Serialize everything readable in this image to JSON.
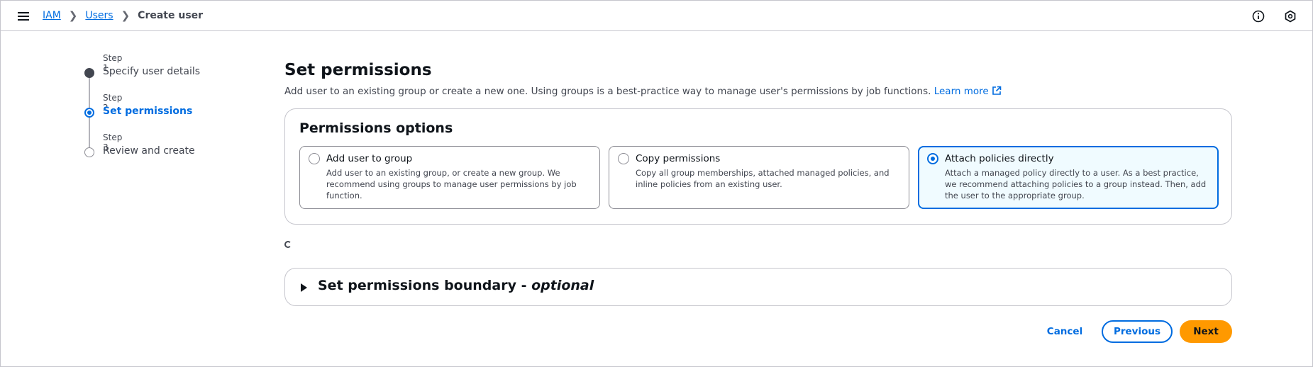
{
  "header": {
    "menu_icon": "hamburger-menu-icon",
    "breadcrumbs": [
      {
        "label": "IAM"
      },
      {
        "label": "Users"
      },
      {
        "label": "Create user"
      }
    ],
    "right_icons": [
      "info-icon",
      "settings-hexagon-icon"
    ]
  },
  "steps": [
    {
      "number": "Step 1",
      "title": "Specify user details",
      "status": "completed"
    },
    {
      "number": "Step 2",
      "title": "Set permissions",
      "status": "current"
    },
    {
      "number": "Step 3",
      "title": "Review and create",
      "status": "upcoming"
    }
  ],
  "main": {
    "title": "Set permissions",
    "description": "Add user to an existing group or create a new one. Using groups is a best-practice way to manage user's permissions by job functions.",
    "learn_more": "Learn more",
    "permissions_options": {
      "title": "Permissions options",
      "options": [
        {
          "title": "Add user to group",
          "description": "Add user to an existing group, or create a new group. We recommend using groups to manage user permissions by job function.",
          "selected": false
        },
        {
          "title": "Copy permissions",
          "description": "Copy all group memberships, attached managed policies, and inline policies from an existing user.",
          "selected": false
        },
        {
          "title": "Attach policies directly",
          "description": "Attach a managed policy directly to a user. As a best practice, we recommend attaching policies to a group instead. Then, add the user to the appropriate group.",
          "selected": true
        }
      ]
    },
    "boundary": {
      "title": "Set permissions boundary - ",
      "optional": "optional"
    }
  },
  "footer": {
    "cancel": "Cancel",
    "previous": "Previous",
    "next": "Next"
  },
  "colors": {
    "accent": "#006ce0",
    "primary_button": "#ff9900",
    "selected_tile_bg": "#f0fbff"
  }
}
